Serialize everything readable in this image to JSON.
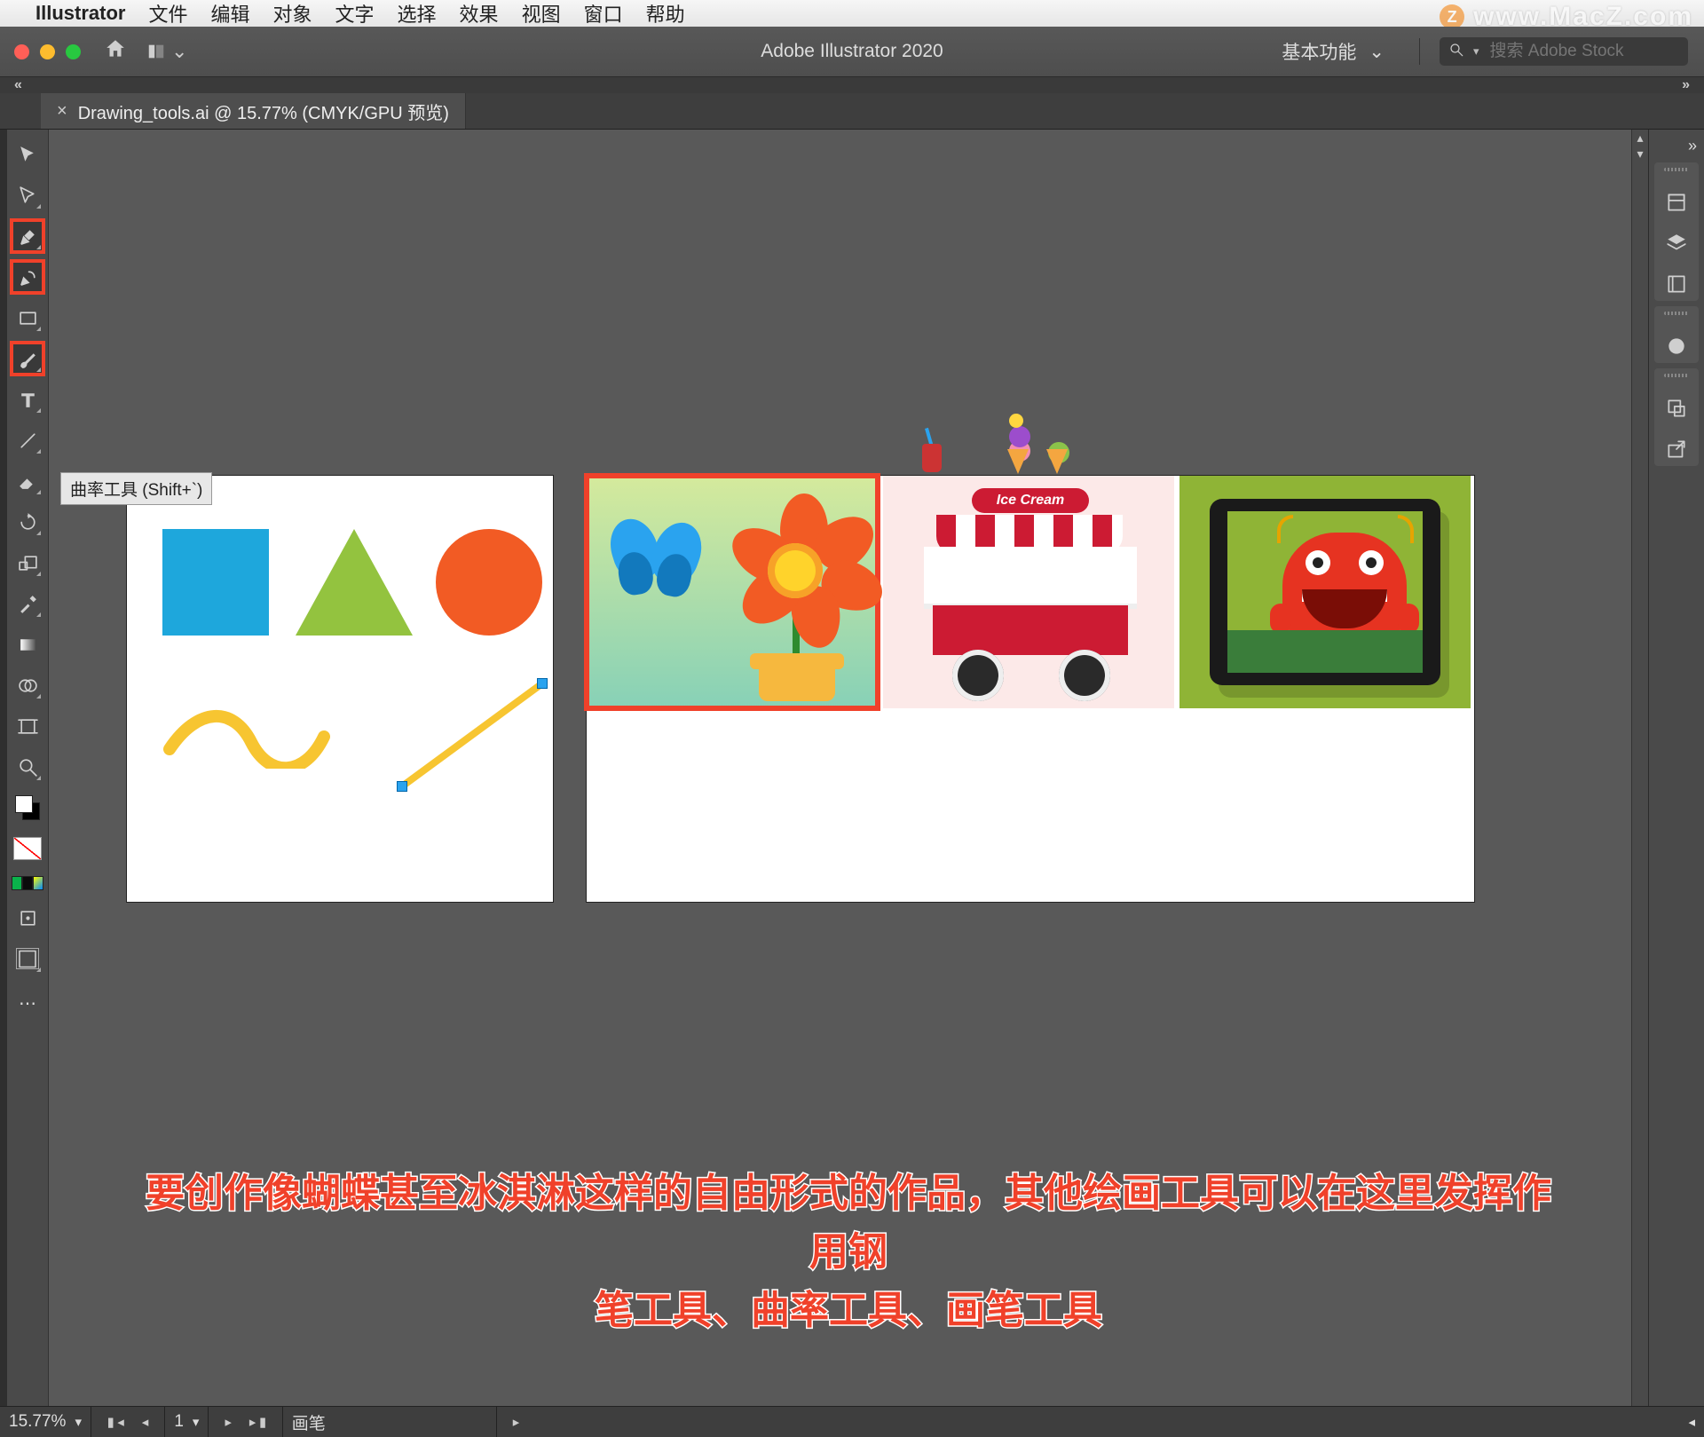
{
  "mac_menu": {
    "apple": "",
    "app_name": "Illustrator",
    "items": [
      "文件",
      "编辑",
      "对象",
      "文字",
      "选择",
      "效果",
      "视图",
      "窗口",
      "帮助"
    ]
  },
  "watermark": {
    "badge": "Z",
    "text": "www.MacZ.com"
  },
  "titlebar": {
    "title": "Adobe Illustrator 2020",
    "workspace_label": "基本功能",
    "search_placeholder": "搜索 Adobe Stock"
  },
  "document_tab": {
    "close": "×",
    "title": "Drawing_tools.ai @ 15.77% (CMYK/GPU 预览)"
  },
  "tooltip": "曲率工具 (Shift+`)",
  "tools": [
    {
      "name": "selection-tool",
      "interact": true
    },
    {
      "name": "direct-selection-tool",
      "interact": true
    },
    {
      "name": "pen-tool",
      "interact": true,
      "hl": true
    },
    {
      "name": "curvature-tool",
      "interact": true,
      "hl": true
    },
    {
      "name": "rectangle-tool",
      "interact": true
    },
    {
      "name": "paintbrush-tool",
      "interact": true,
      "hl": true
    },
    {
      "name": "type-tool",
      "interact": true
    },
    {
      "name": "line-segment-tool",
      "interact": true
    },
    {
      "name": "eraser-tool",
      "interact": true
    },
    {
      "name": "rotate-tool",
      "interact": true
    },
    {
      "name": "scale-tool",
      "interact": true
    },
    {
      "name": "eyedropper-tool",
      "interact": true
    },
    {
      "name": "gradient-tool",
      "interact": true
    },
    {
      "name": "shape-builder-tool",
      "interact": true
    },
    {
      "name": "artboard-tool",
      "interact": true
    },
    {
      "name": "zoom-tool",
      "interact": true
    }
  ],
  "edit_toolbar_more": "⋯",
  "right_panels": [
    {
      "name": "properties-panel-icon"
    },
    {
      "name": "layers-panel-icon"
    },
    {
      "name": "libraries-panel-icon"
    },
    {
      "name": "appearance-panel-icon"
    },
    {
      "name": "asset-export-panel-icon"
    },
    {
      "name": "export-panel-icon"
    }
  ],
  "ice_sign": "Ice Cream",
  "statusbar": {
    "zoom": "15.77%",
    "artboard_index": "1",
    "artboard_name": "画笔",
    "nav_first": "▮◂",
    "nav_prev": "◂",
    "nav_next": "▸",
    "nav_last": "▸▮"
  },
  "subtitle_line1": "要创作像蝴蝶甚至冰淇淋这样的自由形式的作品，其他绘画工具可以在这里发挥作用钢",
  "subtitle_line2": "笔工具、曲率工具、画笔工具"
}
